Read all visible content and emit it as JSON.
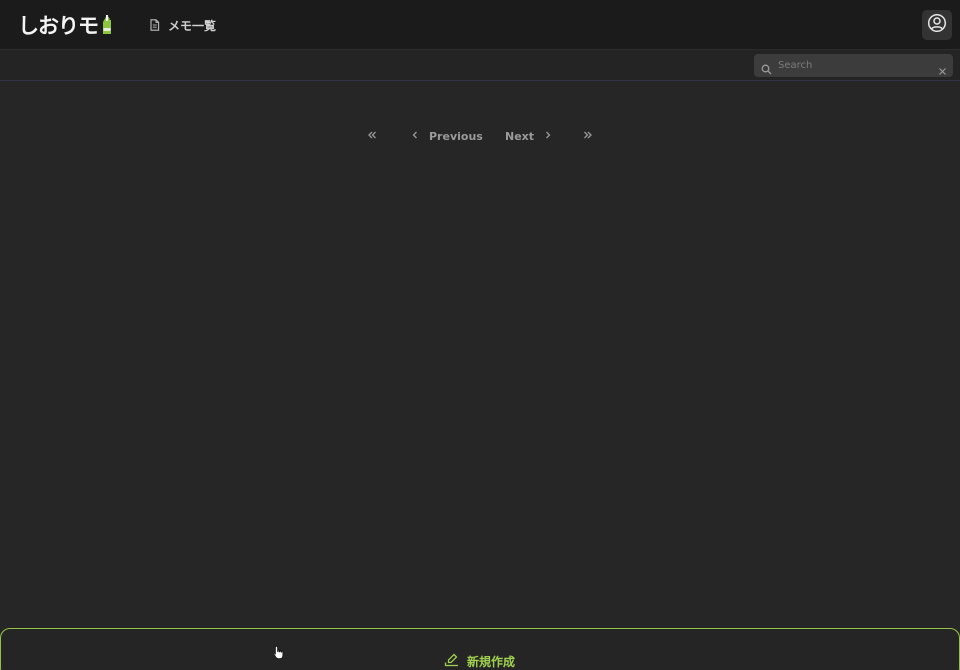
{
  "app": {
    "logo_text": "しおりモ"
  },
  "nav": {
    "memo_list_label": "メモ一覧"
  },
  "search": {
    "placeholder": "Search",
    "value": ""
  },
  "pagination": {
    "previous_label": "Previous",
    "next_label": "Next"
  },
  "footer": {
    "new_label": "新規作成"
  },
  "colors": {
    "accent": "#9fd04f",
    "background": "#262626",
    "header": "#1b1b1b"
  },
  "icons": {
    "memo": "document-icon",
    "account": "user-circle-icon",
    "search": "search-icon",
    "clear": "close-icon",
    "first": "chevrons-left-icon",
    "prev": "chevron-left-icon",
    "next": "chevron-right-icon",
    "last": "chevrons-right-icon",
    "new": "pencil-icon"
  }
}
